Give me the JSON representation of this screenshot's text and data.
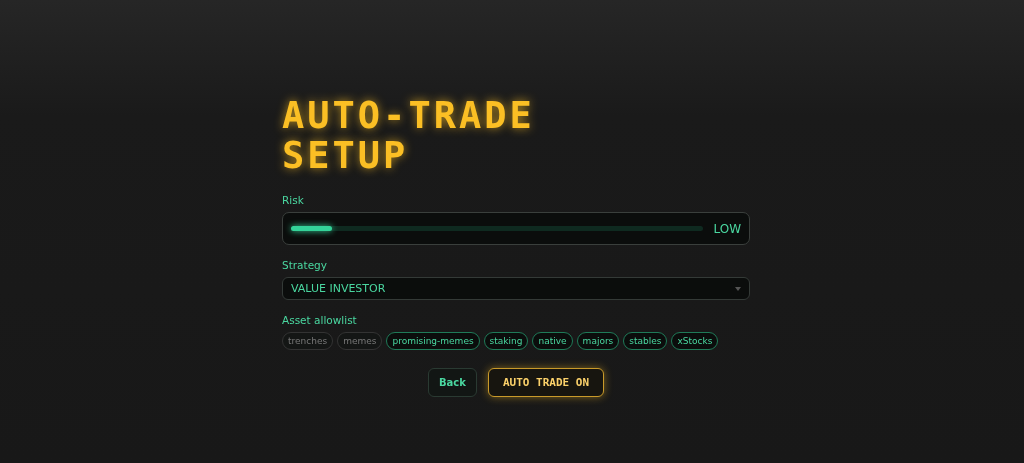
{
  "title": "AUTO-TRADE SETUP",
  "risk": {
    "label": "Risk",
    "level": 0.1,
    "reading": "LOW"
  },
  "strategy": {
    "label": "Strategy",
    "value": "VALUE INVESTOR"
  },
  "allowlist": {
    "label": "Asset allowlist",
    "assets": [
      {
        "label": "trenches",
        "selected": false
      },
      {
        "label": "memes",
        "selected": false
      },
      {
        "label": "promising-memes",
        "selected": true
      },
      {
        "label": "staking",
        "selected": true
      },
      {
        "label": "native",
        "selected": true
      },
      {
        "label": "majors",
        "selected": true
      },
      {
        "label": "stables",
        "selected": true
      },
      {
        "label": "xStocks",
        "selected": true
      }
    ]
  },
  "buttons": [
    {
      "label": "Back",
      "kind": "secondary"
    },
    {
      "label": "AUTO TRADE ON",
      "kind": "primary"
    }
  ]
}
